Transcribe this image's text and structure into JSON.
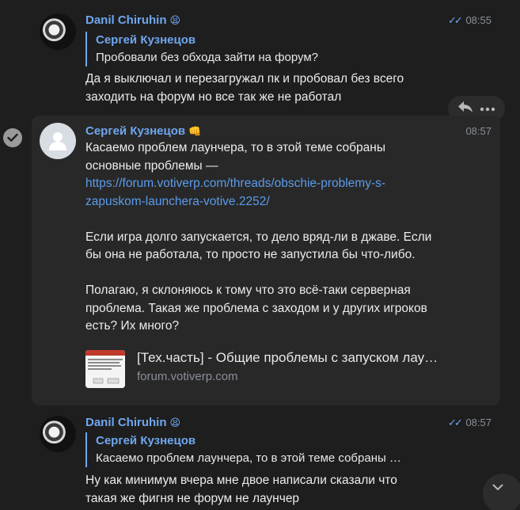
{
  "messages": [
    {
      "author": "Danil Chiruhin",
      "author_emoji": "😫",
      "time": "08:55",
      "read_checks": "✓✓",
      "reply": {
        "author": "Сергей Кузнецов",
        "text": "Пробовали без обхода зайти на форум?"
      },
      "lines": [
        "Да я выключал и перезагружал пк и пробовал без всего",
        "заходить на форум но все так же не работал"
      ]
    },
    {
      "author": "Сергей Кузнецов",
      "author_emoji": "👊",
      "time": "08:57",
      "lines_1": [
        "Касаемо проблем лаунчера, то в этой теме собраны",
        "основные проблемы —"
      ],
      "link_lines": [
        "https://forum.votiverp.com/threads/obschie-problemy-s-",
        "zapuskom-launchera-votive.2252/"
      ],
      "para_2": [
        "Если игра долго запускается, то дело вряд-ли в джаве. Если",
        "бы она не работала, то просто не запустила бы что-либо."
      ],
      "para_3": [
        "Полагаю, я склоняюсь к тому что это всё-таки серверная",
        "проблема. Такая же проблема с заходом и у других игроков",
        "есть? Их много?"
      ],
      "preview": {
        "title": "[Тех.часть] - Общие проблемы с запуском лау…",
        "site": "forum.votiverp.com"
      }
    },
    {
      "author": "Danil Chiruhin",
      "author_emoji": "😫",
      "time": "08:57",
      "read_checks": "✓✓",
      "reply": {
        "author": "Сергей Кузнецов",
        "text": "Касаемо проблем лаунчера, то в этой теме собраны …"
      },
      "lines": [
        "Ну как минимум вчера мне двое написали сказали что",
        "такая же фигня не форум не лаунчер"
      ]
    }
  ],
  "icons": {
    "reply": "reply-arrow-icon",
    "more": "more-dots-icon",
    "select": "check-circle-icon",
    "scroll": "chevron-down-icon"
  },
  "colors": {
    "background": "#1e1e1e",
    "highlight": "#282828",
    "accent": "#6fa7f0",
    "link": "#5b9bec",
    "muted": "#8a8f98"
  }
}
